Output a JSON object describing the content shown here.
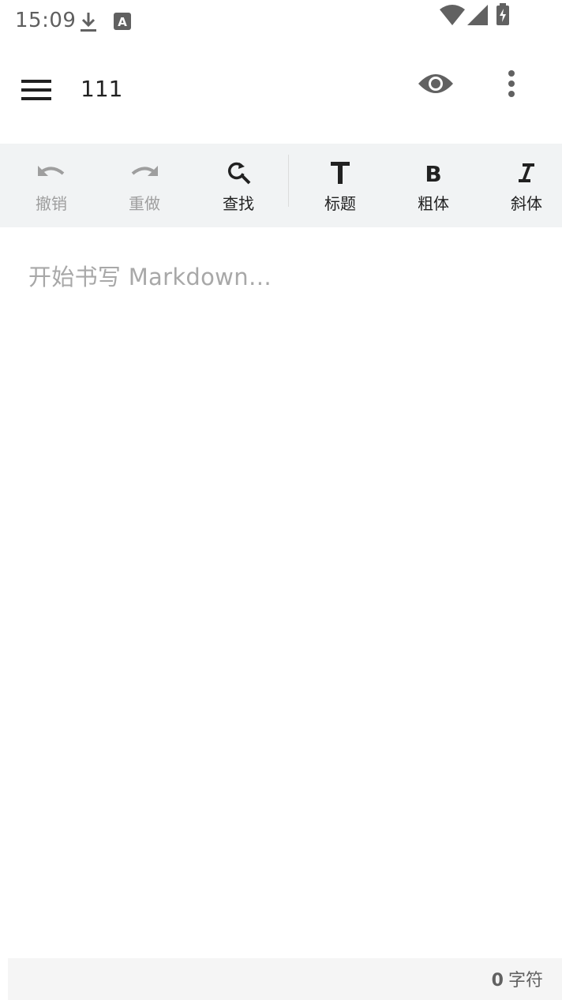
{
  "status_bar": {
    "time": "15:09",
    "icons": [
      "download-icon",
      "keyboard-a-icon",
      "wifi-icon",
      "cell-signal-icon",
      "battery-charging-icon"
    ]
  },
  "app_bar": {
    "title": "111",
    "icons": [
      "menu-icon",
      "eye-icon",
      "more-vert-icon"
    ]
  },
  "toolbar": {
    "items": [
      {
        "label": "撤销",
        "icon": "undo-icon",
        "enabled": false
      },
      {
        "label": "重做",
        "icon": "redo-icon",
        "enabled": false
      },
      {
        "label": "查找",
        "icon": "find-replace-icon",
        "enabled": true
      },
      {
        "label": "标题",
        "icon": "heading-icon",
        "enabled": true
      },
      {
        "label": "粗体",
        "icon": "bold-icon",
        "enabled": true
      },
      {
        "label": "斜体",
        "icon": "italic-icon",
        "enabled": true
      }
    ]
  },
  "editor": {
    "placeholder": "开始书写 Markdown…",
    "value": ""
  },
  "footer": {
    "count": "0",
    "unit": "字符"
  },
  "colors": {
    "toolbar_bg": "#f1f3f4",
    "footer_bg": "#f5f5f5",
    "icon_dark": "#212121",
    "icon_disabled": "#9e9e9e",
    "placeholder": "#a8a8a8"
  }
}
